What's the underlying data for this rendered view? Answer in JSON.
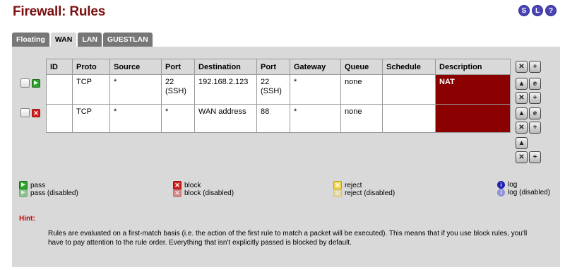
{
  "page": {
    "title": "Firewall: Rules"
  },
  "top_icons": [
    "S",
    "L",
    "?"
  ],
  "tabs": [
    {
      "label": "Floating"
    },
    {
      "label": "WAN"
    },
    {
      "label": "LAN"
    },
    {
      "label": "GUESTLAN"
    }
  ],
  "table": {
    "headers": [
      "ID",
      "Proto",
      "Source",
      "Port",
      "Destination",
      "Port",
      "Gateway",
      "Queue",
      "Schedule",
      "Description"
    ],
    "rows": [
      {
        "status": "pass",
        "id": "",
        "proto": "TCP",
        "source": "*",
        "port": "22 (SSH)",
        "destination": "192.168.2.123",
        "dest_port": "22 (SSH)",
        "gateway": "*",
        "queue": "none",
        "schedule": "",
        "description": "NAT"
      },
      {
        "status": "block",
        "id": "",
        "proto": "TCP",
        "source": "*",
        "port": "*",
        "destination": "WAN address",
        "dest_port": "88",
        "gateway": "*",
        "queue": "none",
        "schedule": "",
        "description": ""
      }
    ]
  },
  "legend": {
    "pass": "pass",
    "pass_disabled": "pass (disabled)",
    "block": "block",
    "block_disabled": "block (disabled)",
    "reject": "reject",
    "reject_disabled": "reject (disabled)",
    "log": "log",
    "log_disabled": "log (disabled)"
  },
  "hint": {
    "label": "Hint:",
    "text": "Rules are evaluated on a first-match basis (i.e. the action of the first rule to match a packet will be executed). This means that if you use block rules, you'll have to pay attention to the rule order. Everything that isn't explicitly passed is blocked by default."
  }
}
